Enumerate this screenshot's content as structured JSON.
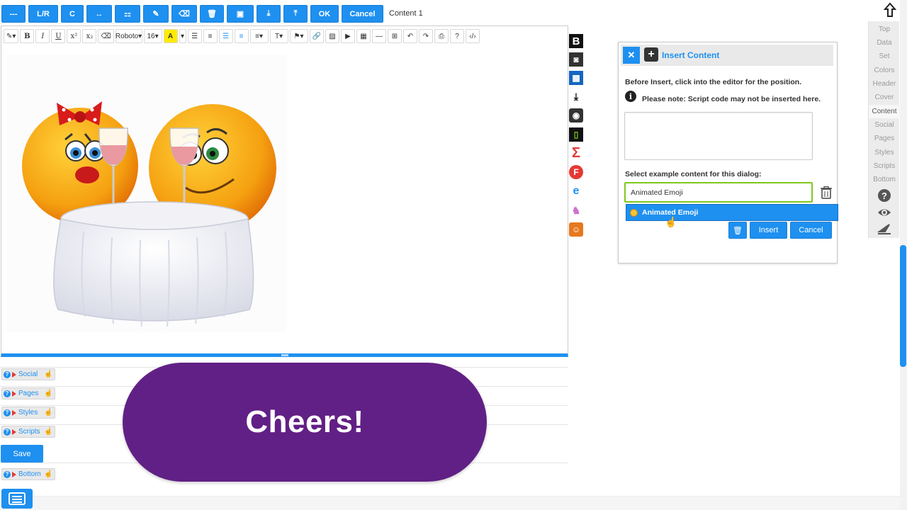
{
  "toolbar": {
    "buttons": [
      "---",
      "L/R",
      "C",
      "↔",
      "⚏",
      "✎",
      "⌫",
      "🗑",
      "▣",
      "⤓",
      "⤒",
      "OK",
      "Cancel"
    ],
    "ok_label": "OK",
    "cancel_label": "Cancel",
    "breadcrumb": "Content 1"
  },
  "editor_toolbar": {
    "font": "Roboto",
    "size": "16"
  },
  "dialog": {
    "title": "Insert Content",
    "before_insert": "Before Insert, click into the editor for the position.",
    "note": "Please note: Script code may not be inserted here.",
    "select_label": "Select example content for this dialog:",
    "select_value": "Animated Emoji",
    "option": "Animated Emoji",
    "insert_label": "Insert",
    "cancel_label": "Cancel"
  },
  "right_nav": {
    "items": [
      "Top",
      "Data",
      "Set",
      "Colors",
      "Header",
      "Cover",
      "Content",
      "Social",
      "Pages",
      "Styles",
      "Scripts",
      "Bottom"
    ],
    "active": "Content"
  },
  "sections": [
    {
      "label": "Social"
    },
    {
      "label": "Pages"
    },
    {
      "label": "Styles"
    },
    {
      "label": "Scripts"
    },
    {
      "label": "Bottom"
    }
  ],
  "save_label": "Save",
  "overlay_text": "Cheers!",
  "icons": [
    "bold-b-icon",
    "camera-icon",
    "calendar-icon",
    "download-icon",
    "globe-icon",
    "document-icon",
    "sigma-icon",
    "f-icon",
    "edge-icon",
    "unicorn-icon",
    "emoji-icon"
  ],
  "colors": {
    "accent": "#1e90f0",
    "purple": "#612085",
    "green": "#7ec81e"
  }
}
